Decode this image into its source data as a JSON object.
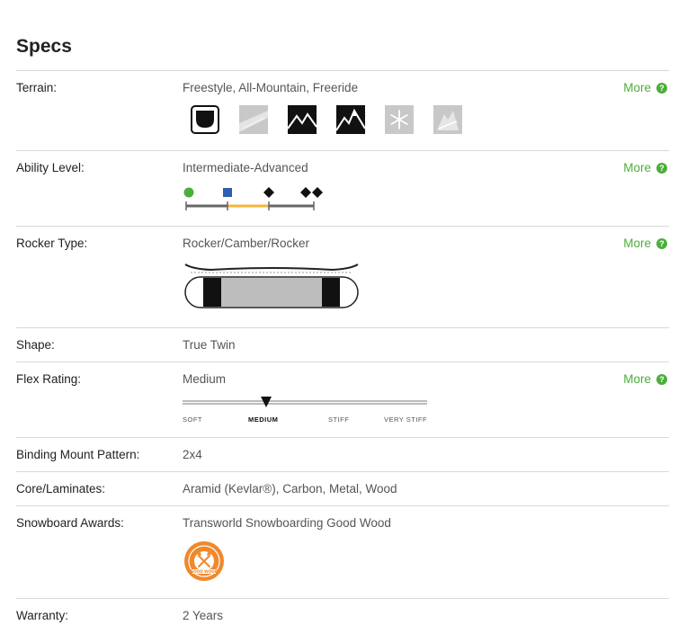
{
  "title": "Specs",
  "more_label": "More",
  "more_icon": "question-circle-icon",
  "accent_color": "#4cae3b",
  "rows": {
    "terrain": {
      "label": "Terrain:",
      "value": "Freestyle, All-Mountain, Freeride",
      "icons": [
        {
          "name": "park-halfpipe-icon",
          "active": true
        },
        {
          "name": "groomer-icon",
          "active": false
        },
        {
          "name": "all-mountain-icon",
          "active": true
        },
        {
          "name": "freeride-icon",
          "active": true
        },
        {
          "name": "powder-snowflake-icon",
          "active": false
        },
        {
          "name": "backcountry-icon",
          "active": false
        }
      ]
    },
    "ability": {
      "label": "Ability Level:",
      "value": "Intermediate-Advanced",
      "levels": [
        "beginner-green-circle-icon",
        "intermediate-blue-square-icon",
        "advanced-black-diamond-icon",
        "expert-double-diamond-icon"
      ],
      "range": [
        "intermediate",
        "advanced"
      ]
    },
    "rocker": {
      "label": "Rocker Type:",
      "value": "Rocker/Camber/Rocker"
    },
    "shape": {
      "label": "Shape:",
      "value": "True Twin"
    },
    "flex": {
      "label": "Flex Rating:",
      "value": "Medium",
      "scale": [
        "SOFT",
        "MEDIUM",
        "STIFF",
        "VERY STIFF"
      ],
      "selected": "MEDIUM"
    },
    "binding": {
      "label": "Binding Mount Pattern:",
      "value": "2x4"
    },
    "core": {
      "label": "Core/Laminates:",
      "value": "Aramid (Kevlar®), Carbon, Metal, Wood"
    },
    "awards": {
      "label": "Snowboard Awards:",
      "value": "Transworld Snowboarding Good Wood",
      "badge_text": "GOOD WOOD",
      "badge_color": "#f0882c"
    },
    "warranty": {
      "label": "Warranty:",
      "value": "2 Years"
    }
  }
}
